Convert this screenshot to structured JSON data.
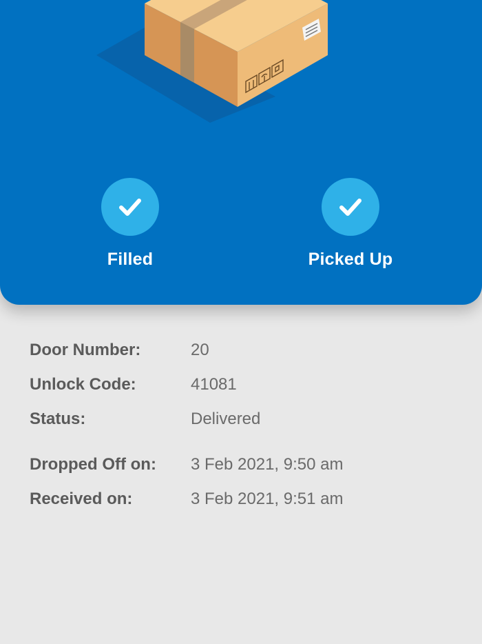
{
  "colors": {
    "hero_background": "#0171c1",
    "check_circle": "#2fb1e8",
    "page_background": "#e8e8e8"
  },
  "illustration": {
    "icon": "cardboard-box-icon"
  },
  "steps": [
    {
      "label": "Filled",
      "icon": "check-icon",
      "completed": true
    },
    {
      "label": "Picked Up",
      "icon": "check-icon",
      "completed": true
    }
  ],
  "details": {
    "door_number": {
      "label": "Door Number:",
      "value": "20"
    },
    "unlock_code": {
      "label": "Unlock Code:",
      "value": "41081"
    },
    "status": {
      "label": "Status:",
      "value": "Delivered"
    },
    "dropped_off": {
      "label": "Dropped Off on:",
      "value": "3 Feb 2021, 9:50 am"
    },
    "received": {
      "label": "Received on:",
      "value": "3 Feb 2021, 9:51 am"
    }
  }
}
